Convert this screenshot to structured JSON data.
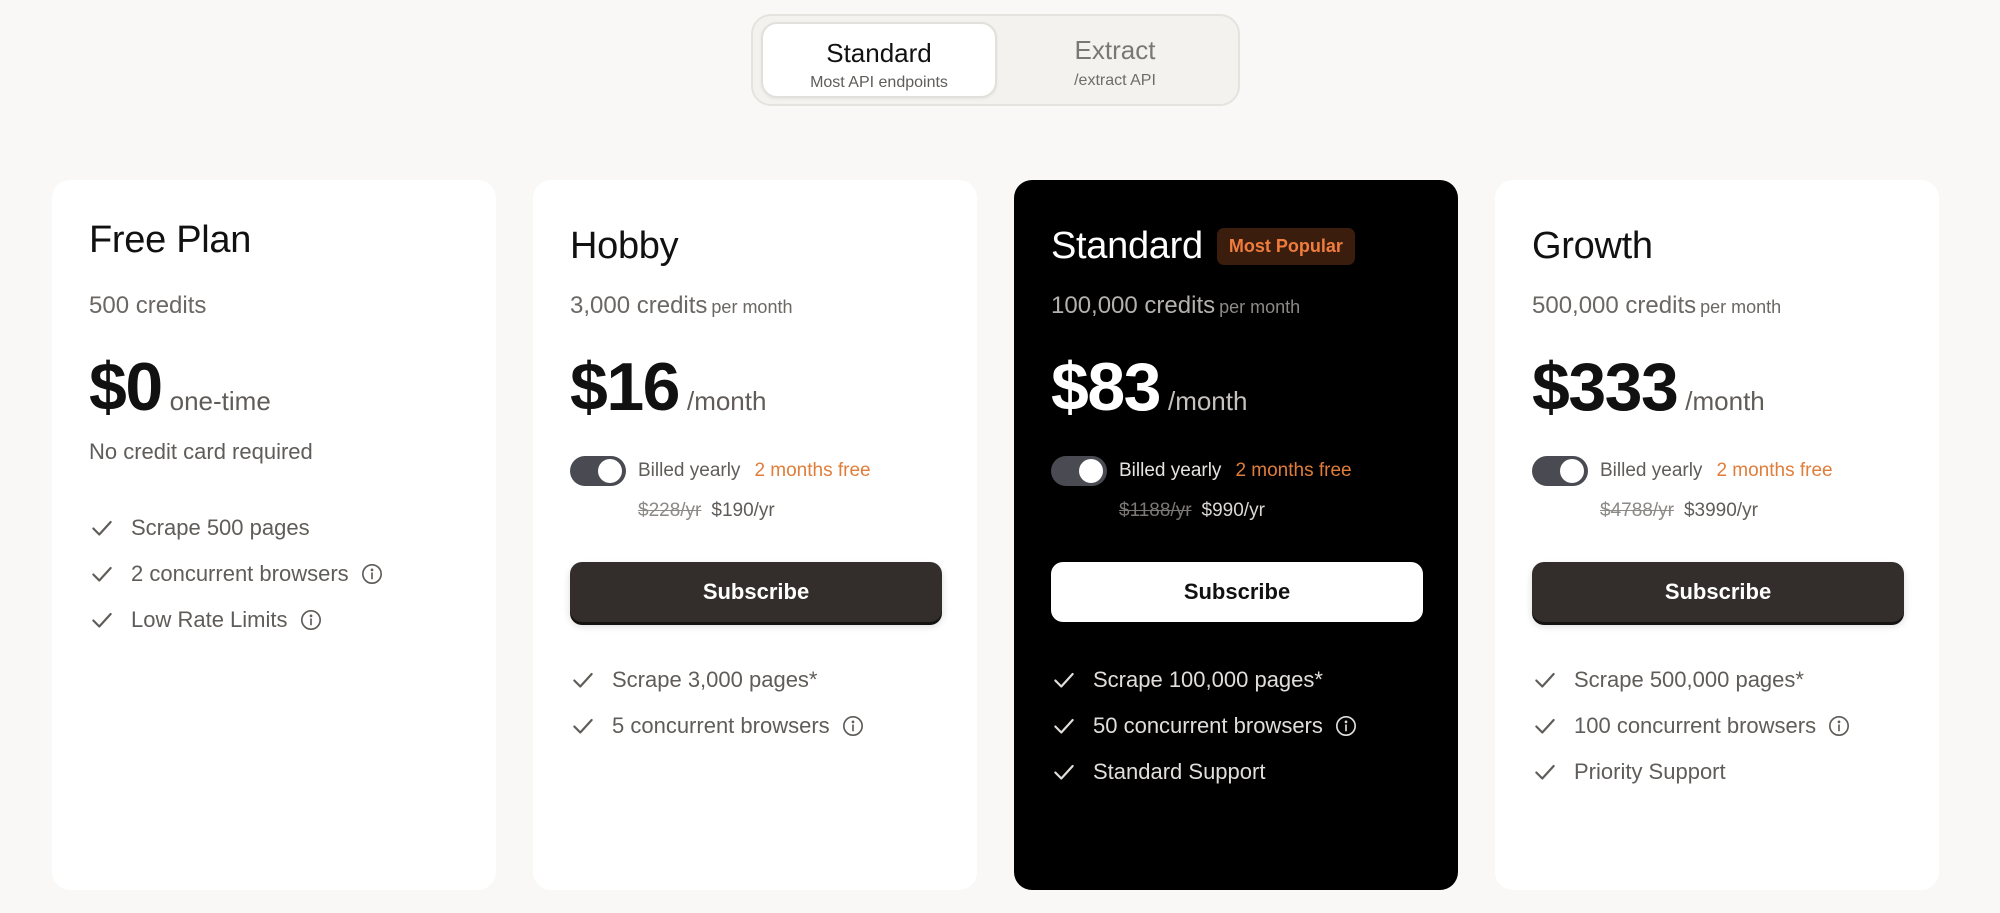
{
  "switcher": {
    "standard": {
      "title": "Standard",
      "sub": "Most API endpoints"
    },
    "extract": {
      "title": "Extract",
      "sub": "/extract API"
    }
  },
  "plans": [
    {
      "name": "Free Plan",
      "credits": "500 credits",
      "price": "$0",
      "period": "one-time",
      "note": "No credit card required",
      "features": [
        {
          "text": "Scrape 500 pages",
          "info": false
        },
        {
          "text": "2 concurrent browsers",
          "info": true
        },
        {
          "text": "Low Rate Limits",
          "info": true
        }
      ]
    },
    {
      "name": "Hobby",
      "credits": "3,000 credits",
      "per": "per month",
      "price": "$16",
      "period": "/month",
      "billing_label": "Billed yearly",
      "billing_yearly_on": true,
      "free_label": "2 months free",
      "old_price": "$228/yr",
      "new_price": "$190/yr",
      "subscribe_label": "Subscribe",
      "features": [
        {
          "text": "Scrape 3,000 pages*",
          "info": false
        },
        {
          "text": "5 concurrent browsers",
          "info": true
        }
      ]
    },
    {
      "name": "Standard",
      "badge": "Most Popular",
      "credits": "100,000 credits",
      "per": "per month",
      "price": "$83",
      "period": "/month",
      "billing_label": "Billed yearly",
      "billing_yearly_on": true,
      "free_label": "2 months free",
      "old_price": "$1188/yr",
      "new_price": "$990/yr",
      "subscribe_label": "Subscribe",
      "features": [
        {
          "text": "Scrape 100,000 pages*",
          "info": false
        },
        {
          "text": "50 concurrent browsers",
          "info": true
        },
        {
          "text": "Standard Support",
          "info": false
        }
      ]
    },
    {
      "name": "Growth",
      "credits": "500,000 credits",
      "per": "per month",
      "price": "$333",
      "period": "/month",
      "billing_label": "Billed yearly",
      "billing_yearly_on": true,
      "free_label": "2 months free",
      "old_price": "$4788/yr",
      "new_price": "$3990/yr",
      "subscribe_label": "Subscribe",
      "features": [
        {
          "text": "Scrape 500,000 pages*",
          "info": false
        },
        {
          "text": "100 concurrent browsers",
          "info": true
        },
        {
          "text": "Priority Support",
          "info": false
        }
      ]
    }
  ],
  "icons": {
    "check": "check-icon",
    "info": "info-icon"
  },
  "colors": {
    "page_bg": "#f9f8f6",
    "accent": "#e07d3a",
    "badge_bg": "#3a1d0d",
    "button": "#332e2b",
    "featured_card": "#000000"
  }
}
